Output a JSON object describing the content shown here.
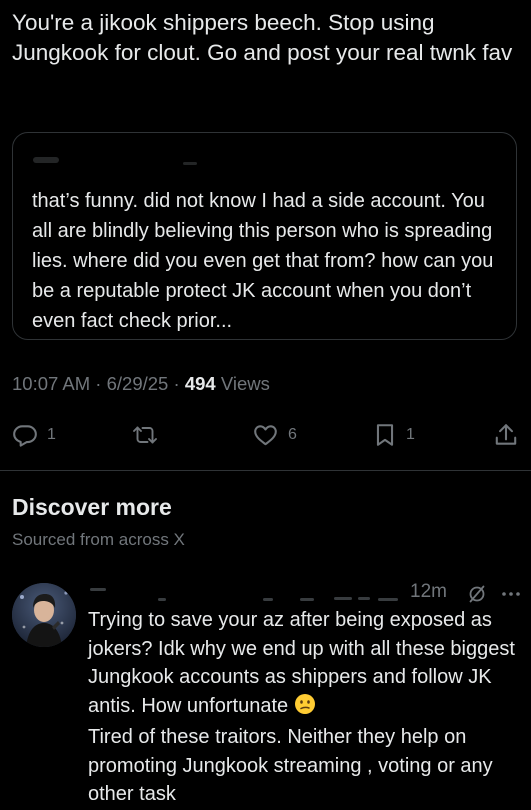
{
  "post": {
    "text": "You're a jikook shippers beech. Stop using Jungkook for clout. Go and post your real twnk fav"
  },
  "quote": {
    "text": "that’s funny. did not know I had a side account. You all are blindly believing this person who is spreading lies. where did you even get that from? how can you be a reputable protect JK account when you don’t even fact check prior..."
  },
  "meta": {
    "time": "10:07 AM",
    "sep1": " · ",
    "date": "6/29/25",
    "sep2": " · ",
    "views_count": "494",
    "views_label": " Views"
  },
  "actions": {
    "reply_count": "1",
    "like_count": "6",
    "bookmark_count": "1"
  },
  "discover": {
    "title": "Discover more",
    "subtitle": "Sourced from across X"
  },
  "reply": {
    "time": "12m",
    "text_main": "Trying to save your az after being exposed as jokers? Idk why we end up with all these biggest Jungkook accounts as shippers and follow JK antis. How unfortunate",
    "text_rest": "Tired of these traitors. Neither they help on promoting Jungkook streaming , voting or any other task"
  },
  "colors": {
    "background": "#000000",
    "text_primary": "#e7e9ea",
    "text_secondary": "#71767b",
    "border": "#2f3336"
  },
  "icons": [
    "reply-icon",
    "retweet-icon",
    "like-icon",
    "bookmark-icon",
    "share-icon",
    "grok-icon",
    "more-icon",
    "confused-face-emoji"
  ]
}
